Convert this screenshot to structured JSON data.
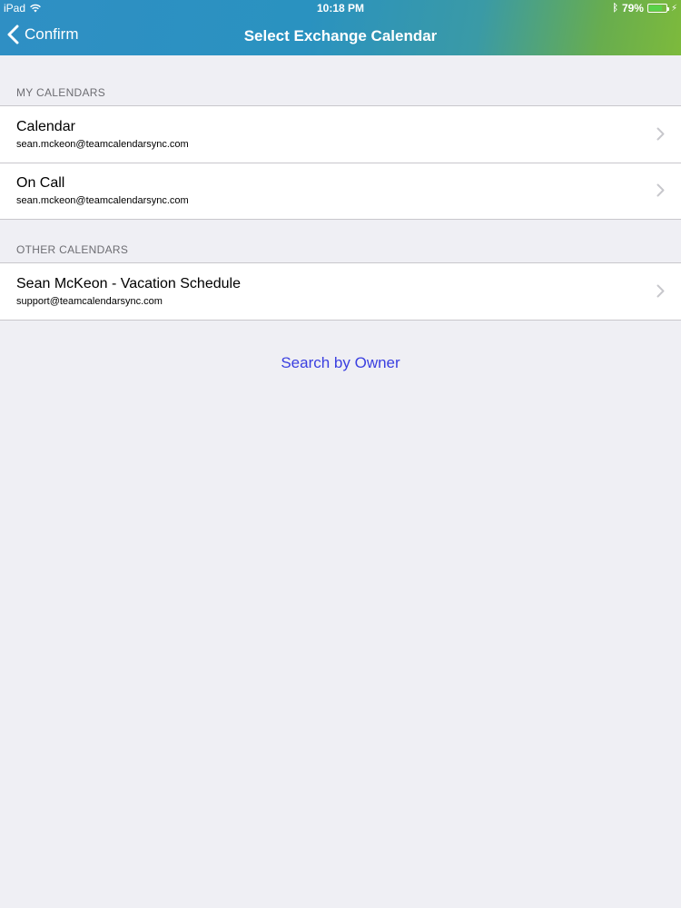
{
  "status_bar": {
    "device": "iPad",
    "time": "10:18 PM",
    "battery_percent": "79%",
    "battery_level": 0.79,
    "icons": [
      "wifi-icon",
      "bluetooth-icon",
      "battery-icon",
      "charging-icon"
    ]
  },
  "nav": {
    "back_label": "Confirm",
    "title": "Select Exchange Calendar"
  },
  "sections": [
    {
      "header": "MY CALENDARS",
      "rows": [
        {
          "title": "Calendar",
          "subtitle": "sean.mckeon@teamcalendarsync.com"
        },
        {
          "title": "On Call",
          "subtitle": "sean.mckeon@teamcalendarsync.com"
        }
      ]
    },
    {
      "header": "OTHER CALENDARS",
      "rows": [
        {
          "title": "Sean McKeon - Vacation Schedule",
          "subtitle": "support@teamcalendarsync.com"
        }
      ]
    }
  ],
  "search_link": "Search by Owner",
  "colors": {
    "bar_start": "#2f8fc4",
    "bar_end": "#7dba3c",
    "background": "#efeff4",
    "link": "#3a3fe0",
    "section_header": "#6d6d72"
  }
}
